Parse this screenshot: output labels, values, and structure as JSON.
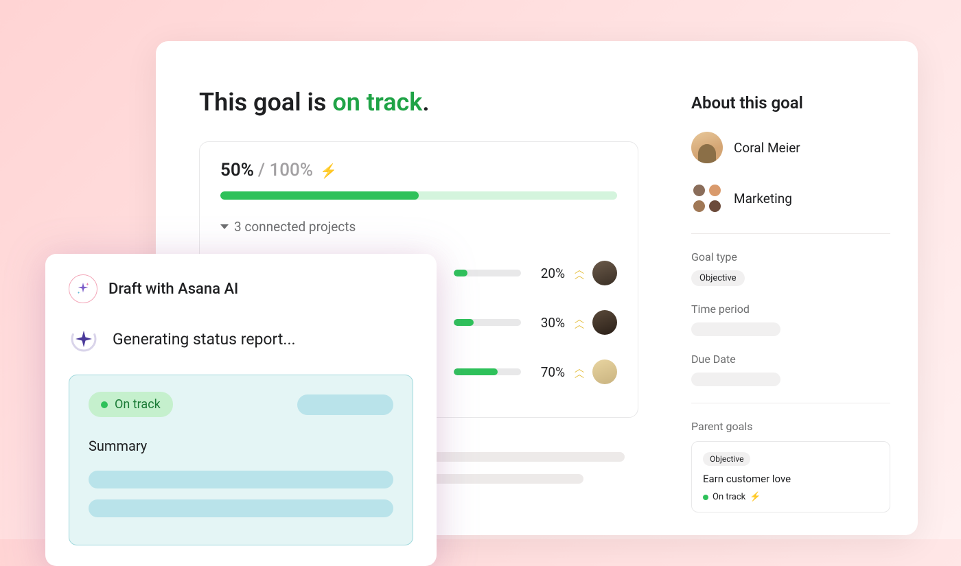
{
  "headline": {
    "prefix": "This goal is ",
    "status": "on track",
    "suffix": "."
  },
  "progress": {
    "current": "50%",
    "separator": " / ",
    "total": "100%",
    "percent": 50
  },
  "connected_projects": {
    "label": "3 connected projects",
    "rows": [
      {
        "percent": 20,
        "label": "20%"
      },
      {
        "percent": 30,
        "label": "30%"
      },
      {
        "percent": 70,
        "label": "70%"
      }
    ]
  },
  "sidebar": {
    "title": "About this goal",
    "owner_name": "Coral Meier",
    "team_name": "Marketing",
    "goal_type_label": "Goal type",
    "goal_type_value": "Objective",
    "time_period_label": "Time period",
    "due_date_label": "Due Date",
    "parent_goals_label": "Parent goals",
    "parent_goal": {
      "chip": "Objective",
      "name": "Earn customer love",
      "status": "On track"
    }
  },
  "ai_panel": {
    "title": "Draft with Asana AI",
    "status_text": "Generating status report...",
    "status_pill": "On track",
    "summary_title": "Summary"
  },
  "colors": {
    "green": "#2ec15a",
    "green_light": "#d4f4dd",
    "teal_bg": "#e4f5f5",
    "teal_chip": "#b9e3ea",
    "bolt": "#f5b400"
  }
}
